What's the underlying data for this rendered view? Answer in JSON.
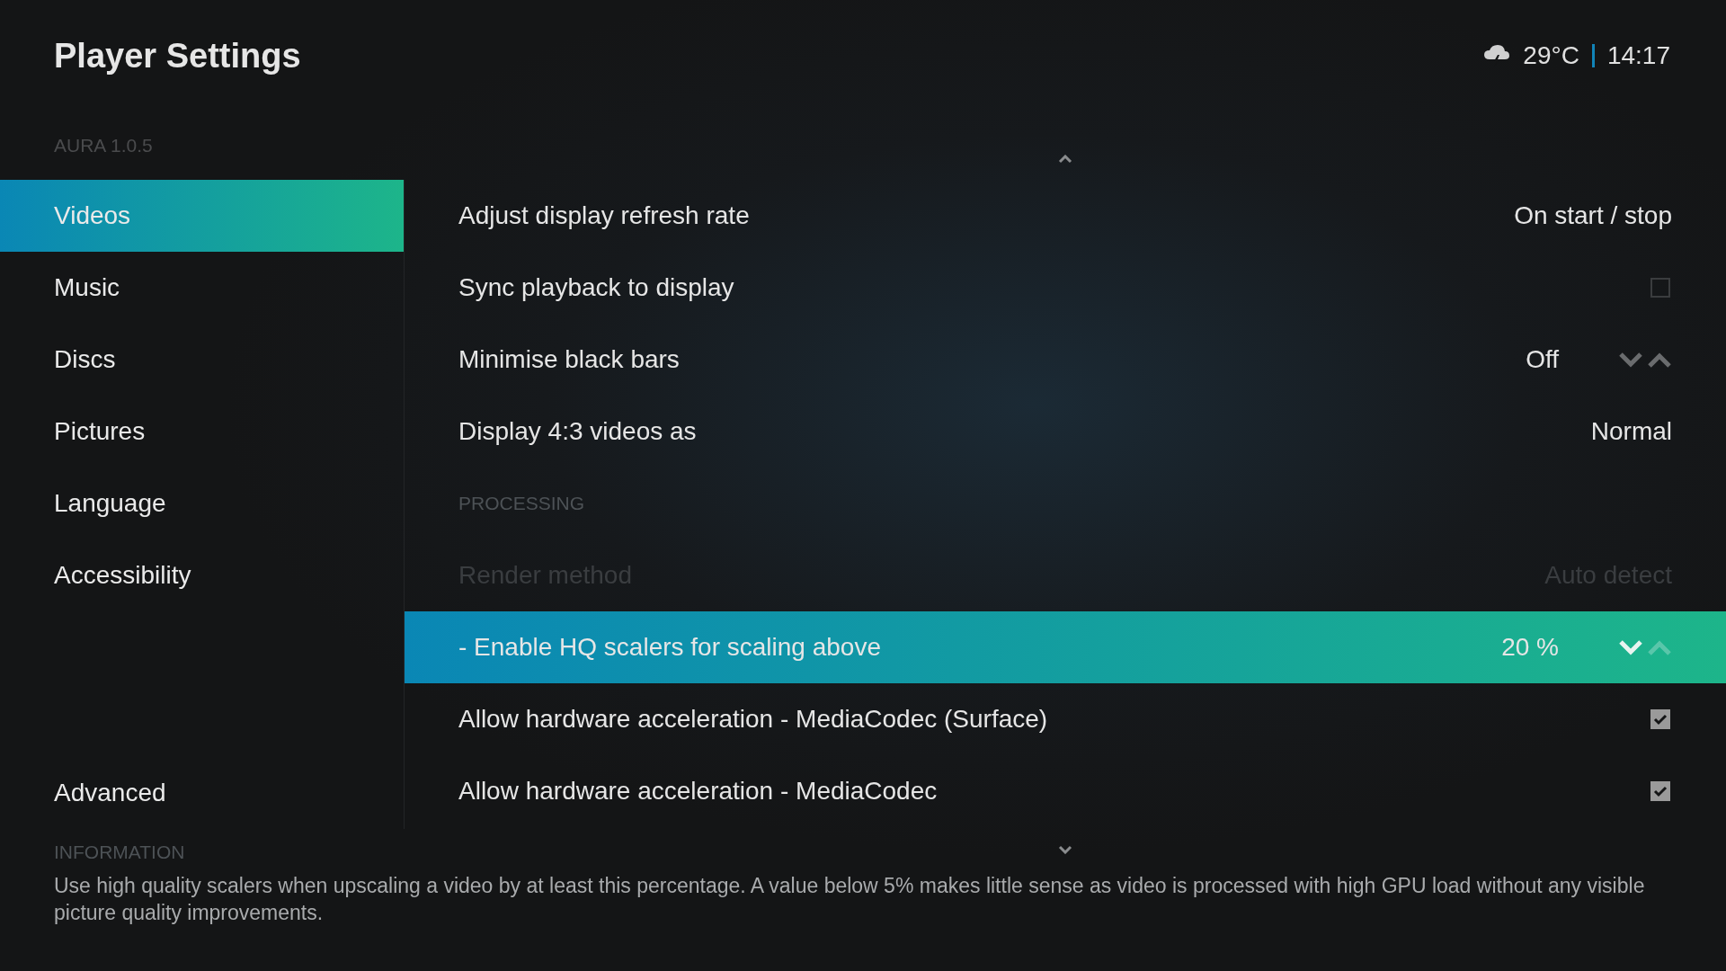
{
  "header": {
    "title": "Player Settings",
    "temperature": "29°C",
    "time": "14:17"
  },
  "skin_version": "AURA 1.0.5",
  "sidebar": {
    "items": [
      {
        "label": "Videos",
        "selected": true
      },
      {
        "label": "Music",
        "selected": false
      },
      {
        "label": "Discs",
        "selected": false
      },
      {
        "label": "Pictures",
        "selected": false
      },
      {
        "label": "Language",
        "selected": false
      },
      {
        "label": "Accessibility",
        "selected": false
      }
    ],
    "bottom_items": [
      {
        "label": "Advanced",
        "selected": false
      }
    ]
  },
  "settings": [
    {
      "kind": "value",
      "label": "Adjust display refresh rate",
      "value": "On start / stop",
      "selected": false,
      "disabled": false
    },
    {
      "kind": "checkbox",
      "label": "Sync playback to display",
      "checked": false,
      "selected": false,
      "disabled": false
    },
    {
      "kind": "spin",
      "label": "Minimise black bars",
      "value": "Off",
      "selected": false,
      "disabled": false,
      "up_enabled": true
    },
    {
      "kind": "value",
      "label": "Display 4:3 videos as",
      "value": "Normal",
      "selected": false,
      "disabled": false
    },
    {
      "kind": "section",
      "label": "PROCESSING"
    },
    {
      "kind": "value",
      "label": "Render method",
      "value": "Auto detect",
      "selected": false,
      "disabled": true
    },
    {
      "kind": "spin",
      "label": "- Enable HQ scalers for scaling above",
      "value": "20 %",
      "selected": true,
      "disabled": false,
      "up_enabled": false
    },
    {
      "kind": "checkbox",
      "label": "Allow hardware acceleration - MediaCodec (Surface)",
      "checked": true,
      "selected": false,
      "disabled": false
    },
    {
      "kind": "checkbox",
      "label": "Allow hardware acceleration - MediaCodec",
      "checked": true,
      "selected": false,
      "disabled": false
    }
  ],
  "information": {
    "heading": "INFORMATION",
    "text": "Use high quality scalers when upscaling a video by at least this percentage. A value below 5% makes little sense as video is processed with high GPU load without any visible picture quality improvements."
  }
}
